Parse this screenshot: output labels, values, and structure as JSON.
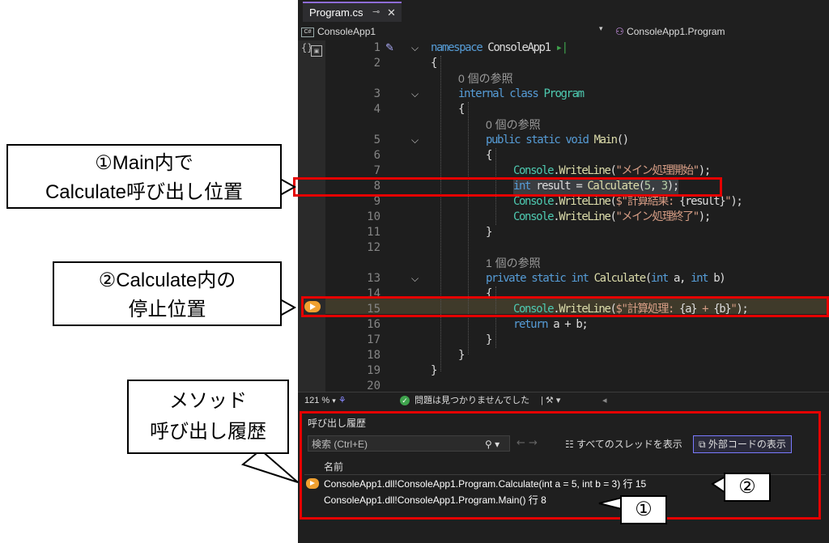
{
  "tab": {
    "title": "Program.cs",
    "pin": "⊸",
    "close": "✕"
  },
  "navbar": {
    "project": "ConsoleApp1",
    "badge": "C#",
    "class_path": "ConsoleApp1.Program",
    "dropdown": "▾"
  },
  "code": {
    "lines": [
      {
        "n": "1",
        "text": "namespace ConsoleApp1 ▸|"
      },
      {
        "n": "2",
        "text": "{"
      },
      {
        "n": "",
        "text": "0 個の参照"
      },
      {
        "n": "3",
        "text": "internal class Program"
      },
      {
        "n": "4",
        "text": "{"
      },
      {
        "n": "",
        "text": "0 個の参照"
      },
      {
        "n": "5",
        "text": "public static void Main()"
      },
      {
        "n": "6",
        "text": "{"
      },
      {
        "n": "7",
        "text": "Console.WriteLine(\"メイン処理開始\");"
      },
      {
        "n": "8",
        "text": "int result = Calculate(5, 3);"
      },
      {
        "n": "9",
        "text": "Console.WriteLine($\"計算結果: {result}\");"
      },
      {
        "n": "10",
        "text": "Console.WriteLine(\"メイン処理終了\");"
      },
      {
        "n": "11",
        "text": "}"
      },
      {
        "n": "12",
        "text": ""
      },
      {
        "n": "",
        "text": "1 個の参照"
      },
      {
        "n": "13",
        "text": "private static int Calculate(int a, int b)"
      },
      {
        "n": "14",
        "text": "{"
      },
      {
        "n": "15",
        "text": "Console.WriteLine($\"計算処理: {a} + {b}\");"
      },
      {
        "n": "16",
        "text": "return a + b;"
      },
      {
        "n": "17",
        "text": "}"
      },
      {
        "n": "18",
        "text": "}"
      },
      {
        "n": "19",
        "text": "}"
      },
      {
        "n": "20",
        "text": ""
      }
    ]
  },
  "status": {
    "zoom": "121 %",
    "issues": "問題は見つかりませんでした"
  },
  "callstack": {
    "title": "呼び出し履歴",
    "search_placeholder": "検索 (Ctrl+E)",
    "show_all_threads": "すべてのスレッドを表示",
    "show_external": "外部コードの表示",
    "column_name": "名前",
    "rows": [
      {
        "text": "ConsoleApp1.dll!ConsoleApp1.Program.Calculate(int a = 5, int b = 3) 行 15",
        "current": true
      },
      {
        "text": "ConsoleApp1.dll!ConsoleApp1.Program.Main() 行 8",
        "current": false
      }
    ]
  },
  "annotations": {
    "callout1": {
      "line1": "①Main内で",
      "line2": "Calculate呼び出し位置"
    },
    "callout2": {
      "line1": "②Calculate内の",
      "line2": "停止位置"
    },
    "callout3": {
      "line1": "メソッド",
      "line2": "呼び出し履歴"
    },
    "badge1": "②",
    "badge2": "①"
  },
  "colors": {
    "highlight_red": "#e50000",
    "breakpoint_arrow": "#f0a030"
  }
}
